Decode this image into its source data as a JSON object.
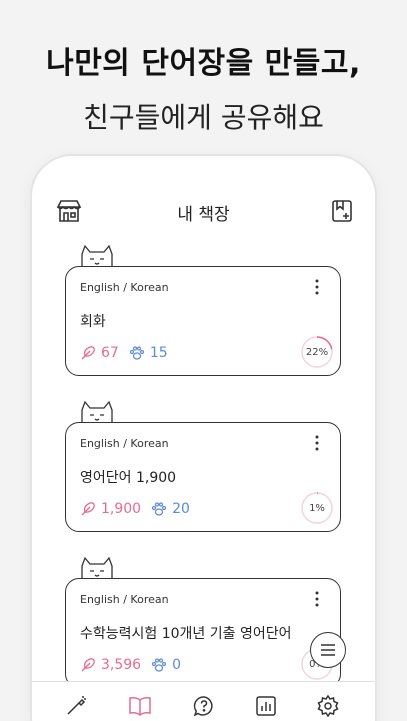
{
  "headline": {
    "line1": "나만의 단어장을 만들고,",
    "line2": "친구들에게 공유해요"
  },
  "topbar": {
    "title": "내 책장",
    "left_icon": "store-icon",
    "right_icon": "add-book-icon"
  },
  "books": [
    {
      "language": "English / Korean",
      "name": "회화",
      "words": "67",
      "likes": "15",
      "progress": "22%",
      "progress_value": 22
    },
    {
      "language": "English / Korean",
      "name": "영어단어 1,900",
      "words": "1,900",
      "likes": "20",
      "progress": "1%",
      "progress_value": 1
    },
    {
      "language": "English / Korean",
      "name": "수학능력시험 10개년 기출 영어단어",
      "words": "3,596",
      "likes": "0",
      "progress": "0%",
      "progress_value": 0
    }
  ],
  "bottom_nav": [
    {
      "name": "wand-icon"
    },
    {
      "name": "book-icon",
      "active": true
    },
    {
      "name": "question-chat-icon"
    },
    {
      "name": "chart-icon"
    },
    {
      "name": "gear-icon"
    }
  ],
  "colors": {
    "accent_pink": "#e86a8c",
    "accent_blue": "#5b8ad8",
    "outline": "#333333"
  }
}
